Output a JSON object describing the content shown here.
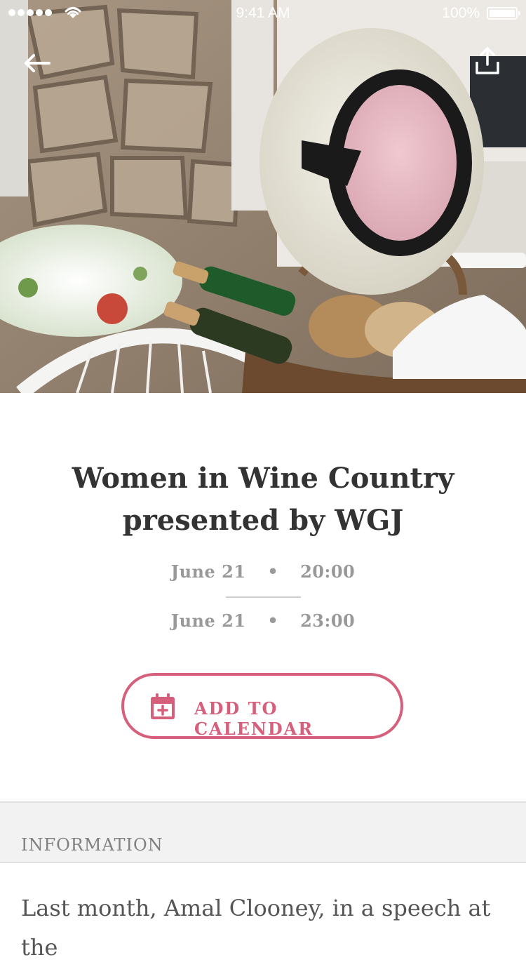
{
  "status_bar": {
    "time": "9:41 AM",
    "battery": "100%"
  },
  "nav": {
    "back_icon": "arrow-left-icon",
    "share_icon": "share-icon"
  },
  "event": {
    "title_line1": "Women in Wine Country",
    "title_line2": "presented by WGJ",
    "start_date": "June 21",
    "start_time": "20:00",
    "end_date": "June 21",
    "end_time": "23:00",
    "separator": "•",
    "add_to_calendar": "ADD TO CALENDAR",
    "accent_color": "#d65f7c"
  },
  "info": {
    "header": "INFORMATION",
    "body": "Last month, Amal Clooney, in a speech at the"
  }
}
